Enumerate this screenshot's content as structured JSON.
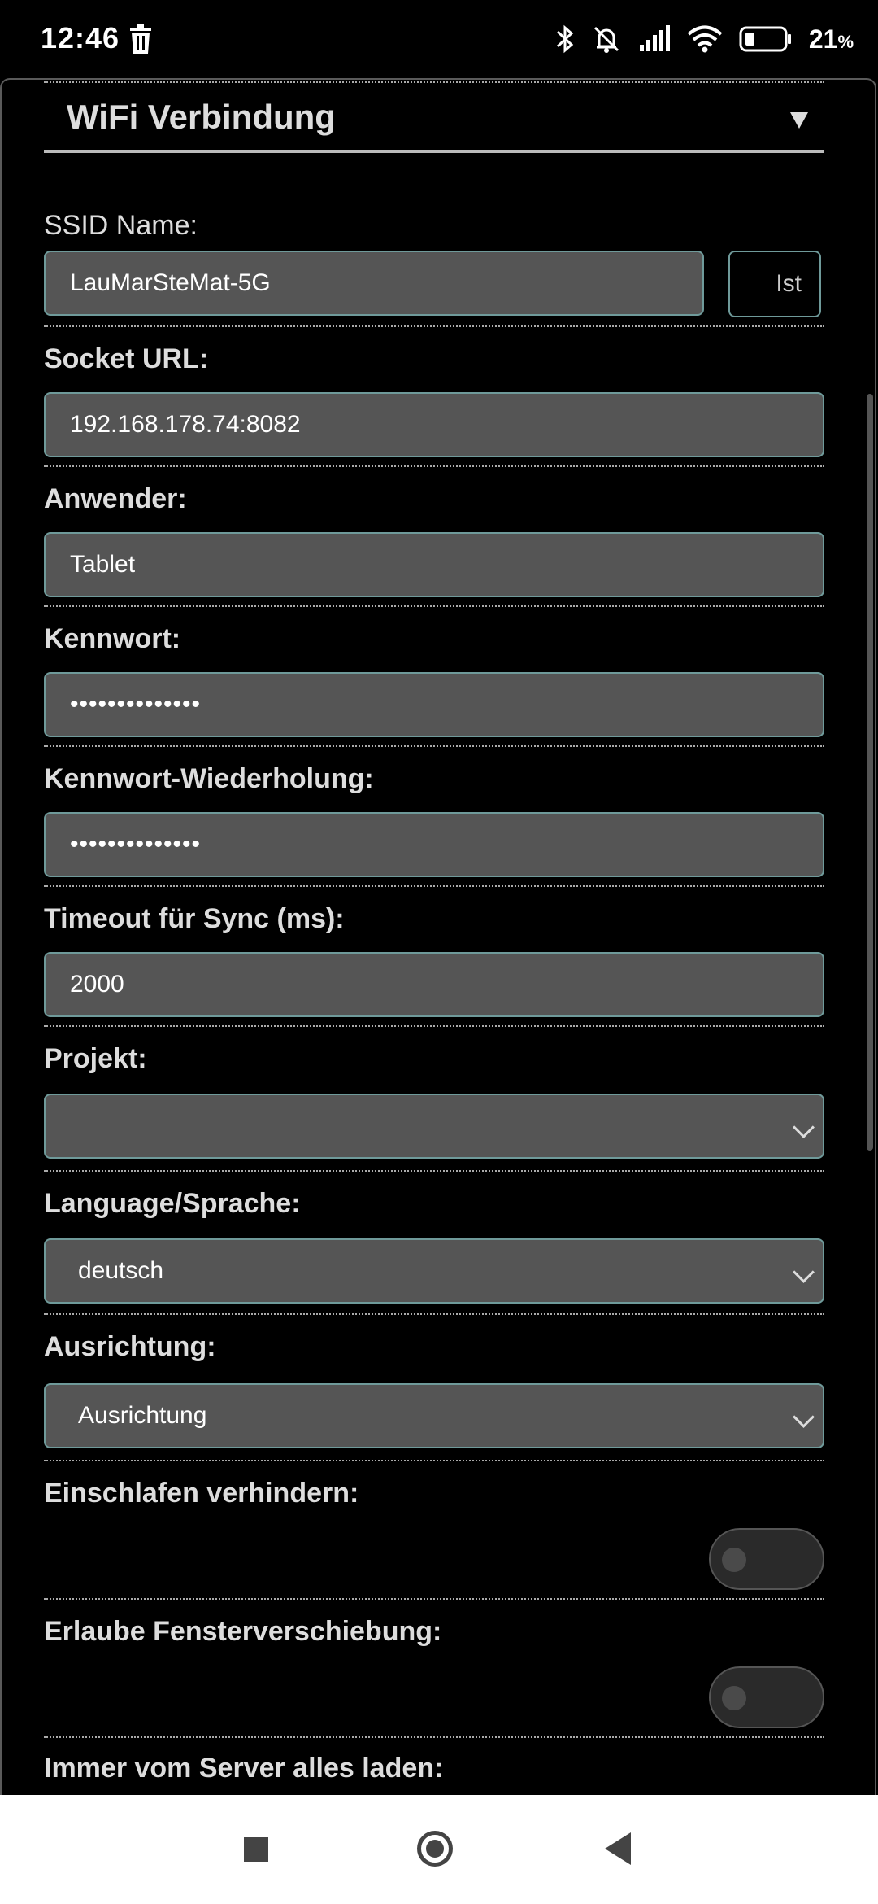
{
  "status_bar": {
    "time": "12:46",
    "battery_percent": "21",
    "battery_unit": "%",
    "icons": [
      "trash-icon",
      "bluetooth-icon",
      "mute-bell-icon",
      "signal-icon",
      "wifi-icon",
      "battery-icon"
    ]
  },
  "section": {
    "title": "WiFi Verbindung",
    "expanded": true
  },
  "ssid": {
    "label": "SSID Name:",
    "value": "LauMarSteMat-5G",
    "button": "Ist"
  },
  "socket_url": {
    "label": "Socket URL:",
    "value": "192.168.178.74:8082"
  },
  "user": {
    "label": "Anwender:",
    "value": "Tablet"
  },
  "password": {
    "label": "Kennwort:",
    "value": "••••••••••••••"
  },
  "password_repeat": {
    "label": "Kennwort-Wiederholung:",
    "value": "••••••••••••••"
  },
  "timeout": {
    "label": "Timeout für Sync (ms):",
    "value": "2000"
  },
  "project": {
    "label": "Projekt:",
    "value": ""
  },
  "language": {
    "label": "Language/Sprache:",
    "value": "deutsch"
  },
  "orientation": {
    "label": "Ausrichtung:",
    "value": "Ausrichtung"
  },
  "prevent_sleep": {
    "label": "Einschlafen verhindern:",
    "on": false
  },
  "allow_window_shift": {
    "label": "Erlaube Fensterverschiebung:",
    "on": false
  },
  "always_load": {
    "label": "Immer vom Server alles laden:"
  },
  "colors": {
    "field_bg": "#555555",
    "field_border": "#6f9a9a",
    "background": "#000000"
  }
}
